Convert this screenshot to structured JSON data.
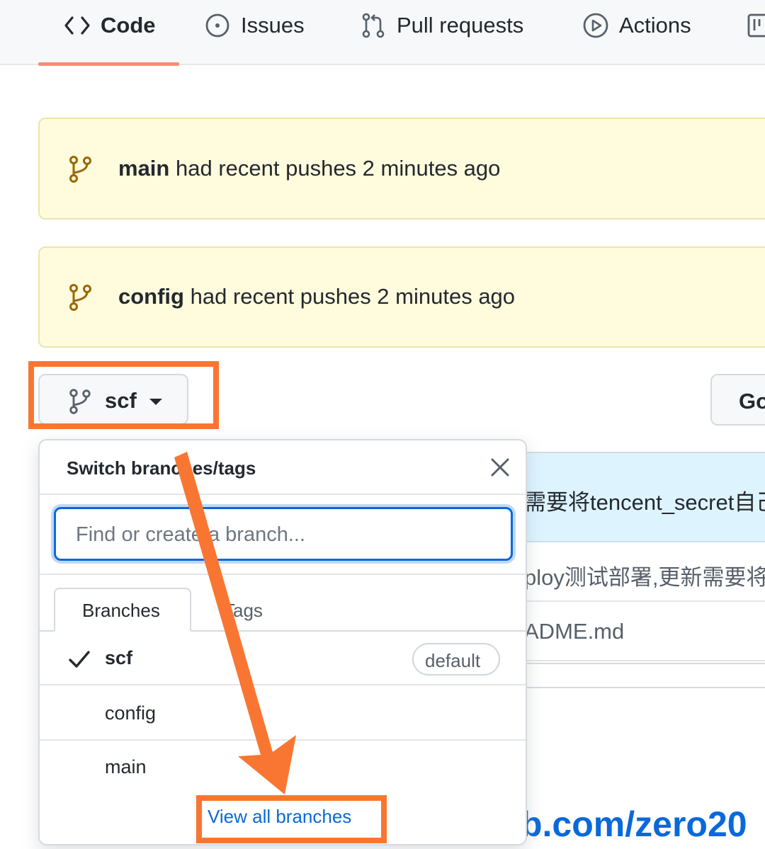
{
  "nav": {
    "tabs": [
      {
        "label": "Code",
        "icon": "code-icon",
        "active": true
      },
      {
        "label": "Issues",
        "icon": "issue-opened-icon"
      },
      {
        "label": "Pull requests",
        "icon": "git-pull-request-icon"
      },
      {
        "label": "Actions",
        "icon": "play-icon"
      },
      {
        "label": "",
        "icon": "project-icon"
      }
    ]
  },
  "banners": [
    {
      "branch": "main",
      "text": "had recent pushes 2 minutes ago"
    },
    {
      "branch": "config",
      "text": "had recent pushes 2 minutes ago"
    }
  ],
  "branch_button": {
    "label": "scf"
  },
  "goto_button": {
    "label": "Go"
  },
  "file_list": {
    "commit_message": "需要将tencent_secret自己",
    "rows": [
      "ploy测试部署,更新需要将",
      "ADME.md"
    ]
  },
  "repo_url_fragment": "b.com/zero20",
  "dropdown": {
    "title": "Switch branches/tags",
    "search_placeholder": "Find or create a branch...",
    "tabs": [
      "Branches",
      "Tags"
    ],
    "branches": [
      {
        "name": "scf",
        "selected": true,
        "badge": "default"
      },
      {
        "name": "config",
        "selected": false
      },
      {
        "name": "main",
        "selected": false
      }
    ],
    "view_all_label": "View all branches"
  },
  "colors": {
    "highlight": "#f97632",
    "link": "#0969da",
    "banner_bg": "#fffbdd",
    "tab_underline": "#fd8c73"
  }
}
